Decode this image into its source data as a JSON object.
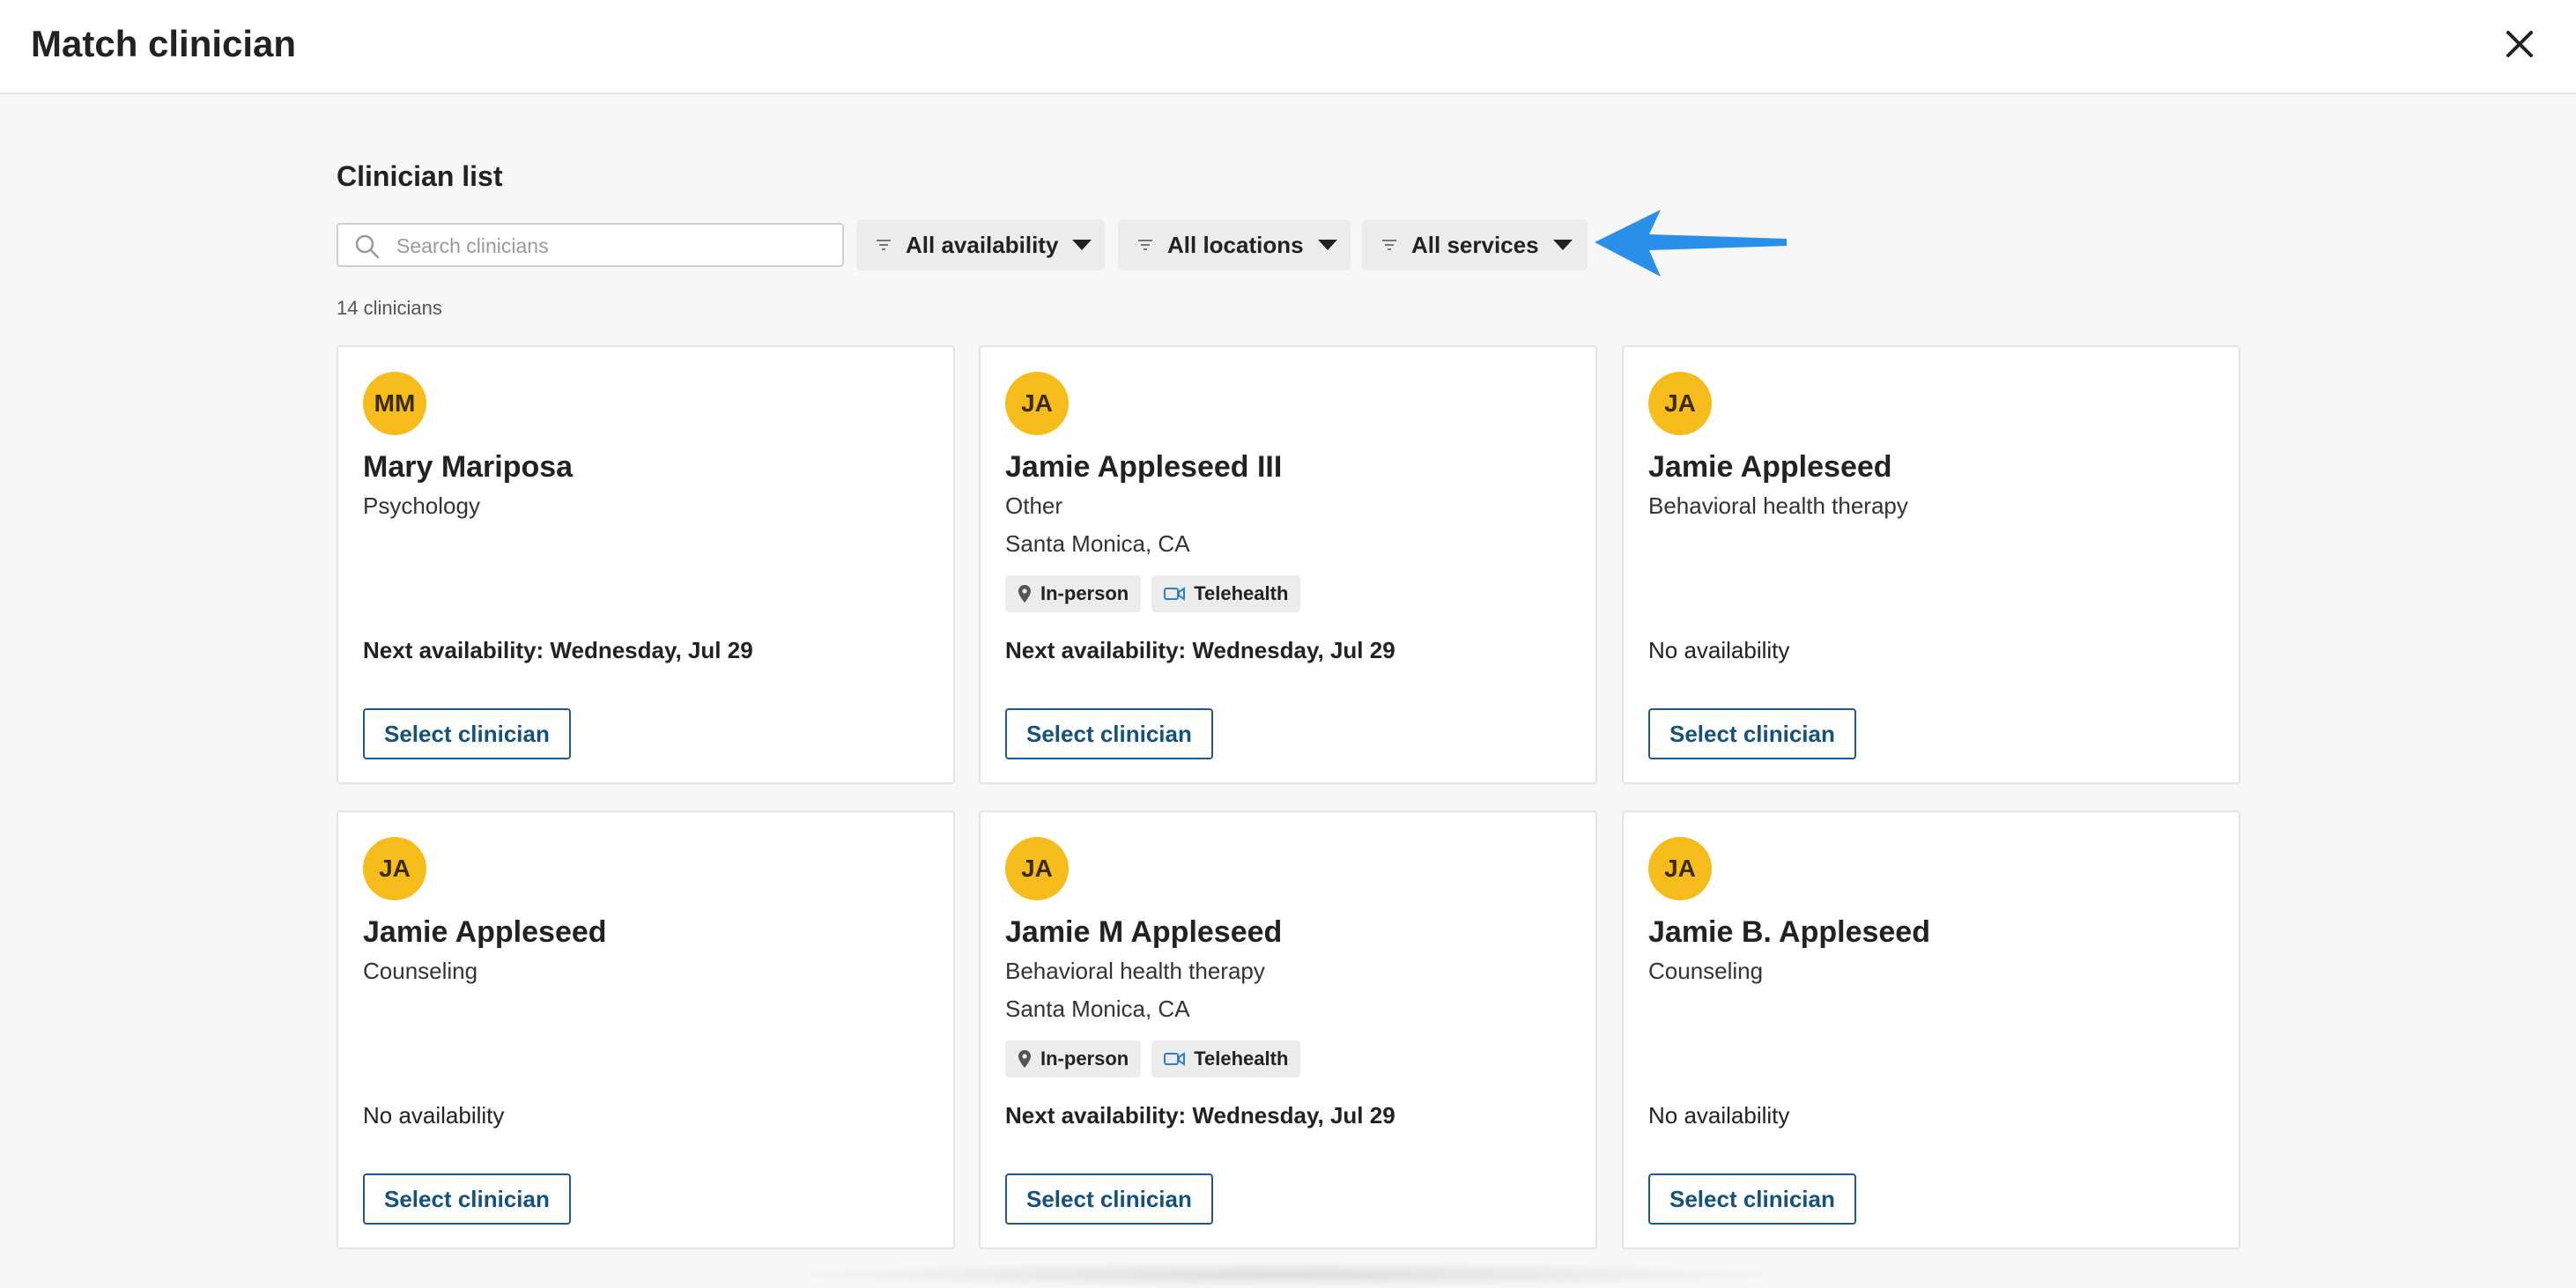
{
  "header": {
    "title": "Match clinician",
    "close_icon": "close-icon"
  },
  "section": {
    "title": "Clinician list"
  },
  "search": {
    "placeholder": "Search clinicians",
    "value": ""
  },
  "filters": [
    {
      "label": "All availability",
      "icon": "filter-icon"
    },
    {
      "label": "All locations",
      "icon": "filter-icon"
    },
    {
      "label": "All services",
      "icon": "filter-icon"
    }
  ],
  "annotation": {
    "icon": "arrow-pointer-icon",
    "color": "#2a8fe8"
  },
  "count_text": "14 clinicians",
  "colors": {
    "avatar": "#f5bc1c",
    "button_text": "#13517f",
    "button_border": "#1d5a8f"
  },
  "clinicians": [
    {
      "initials": "MM",
      "name": "Mary Mariposa",
      "specialty": "Psychology",
      "location": "",
      "tags": [],
      "availability": "Next availability: Wednesday, Jul 29",
      "button": "Select clinician"
    },
    {
      "initials": "JA",
      "name": "Jamie Appleseed III",
      "specialty": "Other",
      "location": "Santa Monica, CA",
      "tags": [
        "In-person",
        "Telehealth"
      ],
      "availability": "Next availability: Wednesday, Jul 29",
      "button": "Select clinician"
    },
    {
      "initials": "JA",
      "name": "Jamie Appleseed",
      "specialty": "Behavioral health therapy",
      "location": "",
      "tags": [],
      "availability": "No availability",
      "button": "Select clinician"
    },
    {
      "initials": "JA",
      "name": "Jamie Appleseed",
      "specialty": "Counseling",
      "location": "",
      "tags": [],
      "availability": "No availability",
      "button": "Select clinician"
    },
    {
      "initials": "JA",
      "name": "Jamie M Appleseed",
      "specialty": "Behavioral health therapy",
      "location": "Santa Monica, CA",
      "tags": [
        "In-person",
        "Telehealth"
      ],
      "availability": "Next availability: Wednesday, Jul 29",
      "button": "Select clinician"
    },
    {
      "initials": "JA",
      "name": "Jamie B. Appleseed",
      "specialty": "Counseling",
      "location": "",
      "tags": [],
      "availability": "No availability",
      "button": "Select clinician"
    }
  ]
}
